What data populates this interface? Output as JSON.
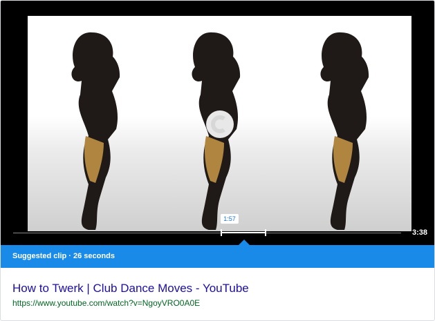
{
  "player": {
    "current_time": "1:57",
    "duration": "3:38",
    "video_description": "",
    "colors": {
      "accent": "#1a8ae8",
      "background": "#000000"
    }
  },
  "clip": {
    "label": "Suggested clip · 26 seconds"
  },
  "result": {
    "title": "How to Twerk | Club Dance Moves - YouTube",
    "url": "https://www.youtube.com/watch?v=NgoyVRO0A0E",
    "title_color": "#1a0dab",
    "url_color": "#006621"
  },
  "icons": {
    "play_indicator": "play-arc-icon"
  }
}
